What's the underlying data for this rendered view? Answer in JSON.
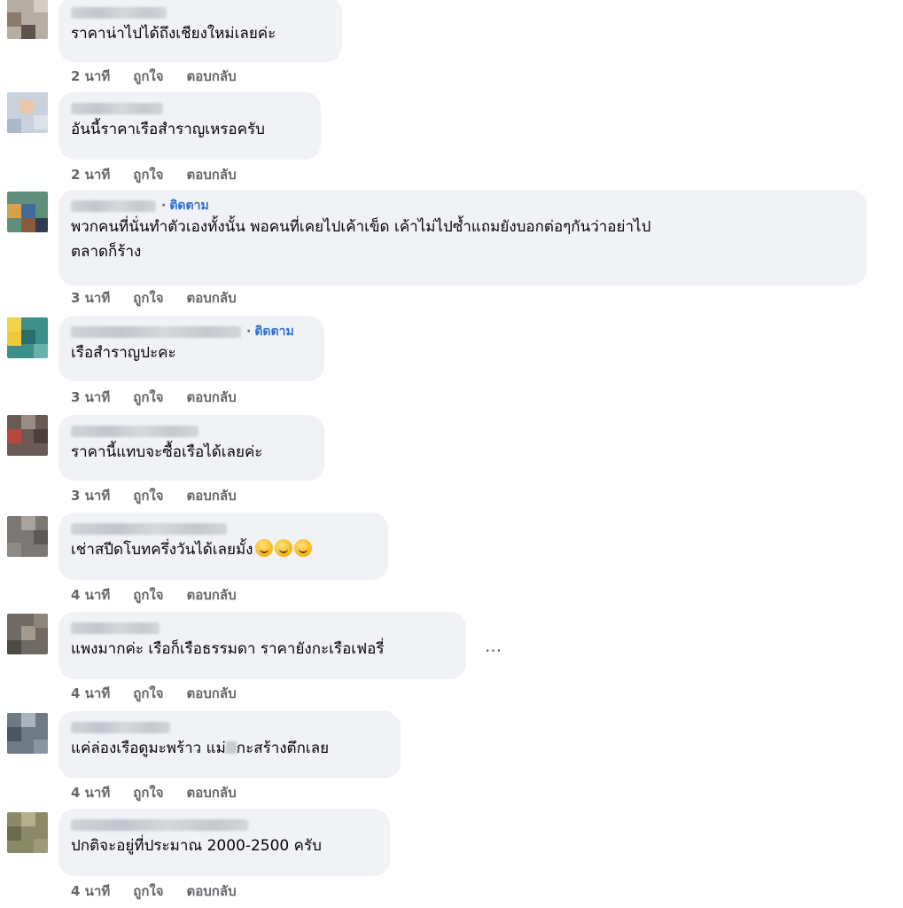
{
  "actions": {
    "time_unit": "นาที",
    "like": "ถูกใจ",
    "reply": "ตอบกลับ",
    "follow": "ติดตาม"
  },
  "comments": [
    {
      "text": "ราคาน่าไปได้ถึงเชียงใหม่เลยค่ะ",
      "minutes": "2",
      "following": false
    },
    {
      "text": "อันนี้ราคาเรือสำราญเหรอครับ",
      "minutes": "2",
      "following": false
    },
    {
      "text": "พวกคนที่นั่นทำตัวเองทั้งนั้น พอคนที่เคยไปเค้าเข็ด เค้าไม่ไปซ้ำแถมยังบอกต่อๆกันว่าอย่าไป\nตลาดก็ร้าง",
      "minutes": "3",
      "following": true
    },
    {
      "text": "เรือสำราญปะคะ",
      "minutes": "3",
      "following": true
    },
    {
      "text": "ราคานี้แทบจะซื้อเรือได้เลยค่ะ",
      "minutes": "3",
      "following": false
    },
    {
      "text": "เช่าสปีดโบทครึ่งวันได้เลยมั้ง",
      "minutes": "4",
      "following": false,
      "emoji_count": 3
    },
    {
      "text": "แพงมากค่ะ เรือก็เรือธรรมดา ราคายังกะเรือเฟอรี่",
      "minutes": "4",
      "following": false,
      "more_menu": "..."
    },
    {
      "text_before": "แค่ล่องเรือดูมะพร้าว แม่",
      "text_after": "กะสร้างตึกเลย",
      "minutes": "4",
      "following": false
    },
    {
      "text": "ปกติจะอยู่ที่ประมาณ 2000-2500 ครับ",
      "minutes": "4",
      "following": false
    }
  ]
}
